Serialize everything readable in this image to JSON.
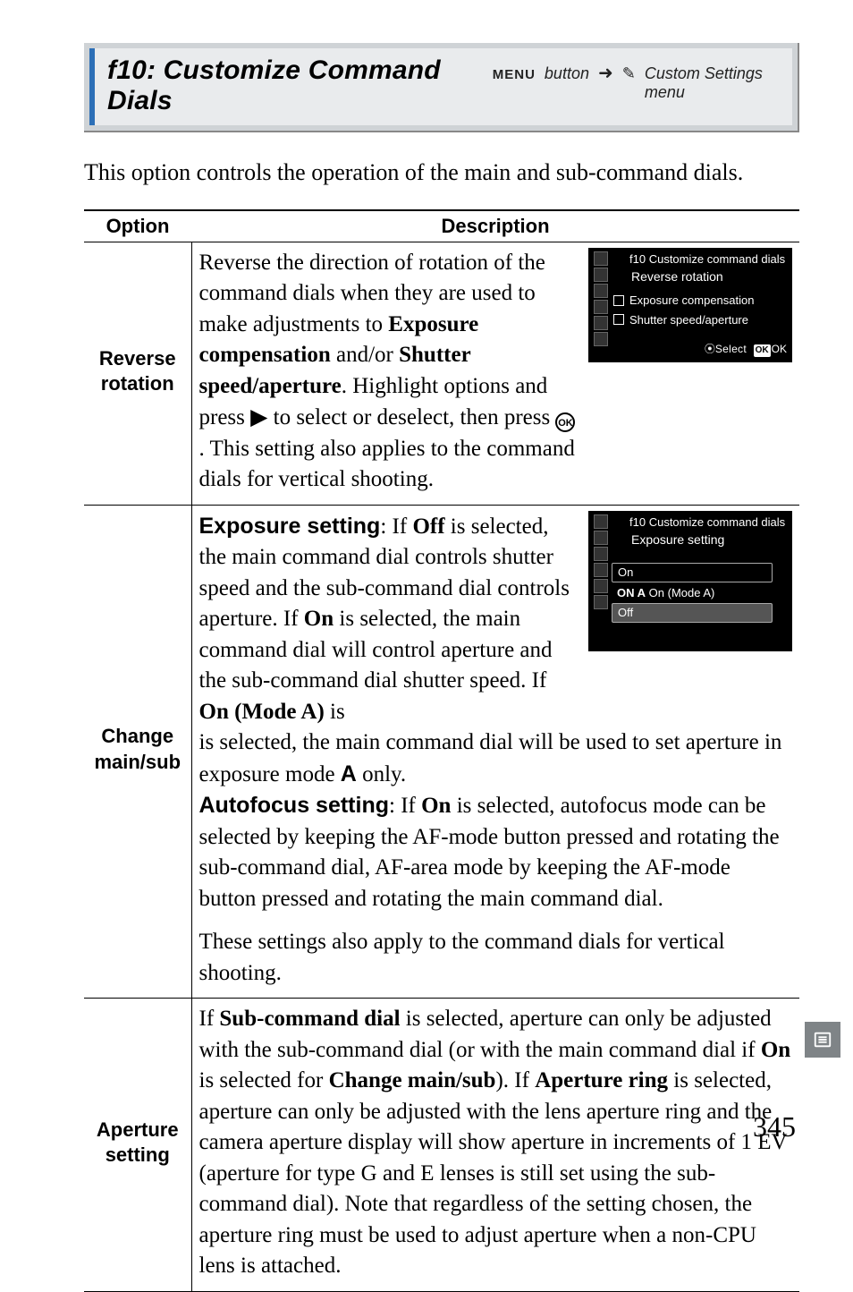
{
  "header": {
    "title": "f10: Customize Command Dials",
    "menu_label": "MENU",
    "button_label": "button",
    "arrow": "➜",
    "pencil": "✎",
    "menu_name": "Custom Settings menu"
  },
  "intro": "This option controls the operation of the main and sub-command dials.",
  "table": {
    "col_option": "Option",
    "col_desc": "Description",
    "rows": [
      {
        "name": "Reverse rotation",
        "text_parts": {
          "p1a": "Reverse the direction of rotation of the command dials when they are used to make adjustments to ",
          "b1": "Exposure compensation",
          "p1b": " and/or ",
          "b2": "Shutter speed/aperture",
          "p1c": ".  Highlight options and press ",
          "tri": "▶",
          "p1d": " to select or deselect, then press ",
          "ok": "OK",
          "p1e": ". This setting also applies to the command dials for vertical shooting."
        },
        "lcd": {
          "hdr_prefix": "f10",
          "hdr": "Customize command dials",
          "sub": "Reverse rotation",
          "opts": [
            "Exposure compensation",
            "Shutter speed/aperture"
          ],
          "footer_select": "Select",
          "footer_ok": "OK",
          "footer_ok2": "OK"
        }
      },
      {
        "name": "Change main/sub",
        "text_parts": {
          "seg1_label": "Exposure setting",
          "seg1a": ": If ",
          "seg1_off": "Off",
          "seg1b": " is selected, the main command dial controls shutter speed and the sub-command dial controls aperture.  If ",
          "seg1_on": "On",
          "seg1c": " is selected, the main command dial will control aperture and the sub-command dial shutter speed.  If ",
          "seg1_onA": "On (Mode A)",
          "seg1d": " is selected, the main command dial will be used to set aperture in exposure mode ",
          "modeA": "A",
          "seg1e": " only.",
          "seg2_label": "Autofocus setting",
          "seg2a": ": If ",
          "seg2_on": "On",
          "seg2b": " is selected, autofocus mode can be selected by keeping the AF-mode button pressed and rotating the sub-command dial, AF-area mode by keeping the AF-mode button pressed and rotating the main command dial.",
          "seg3": "These settings also apply to the command dials for vertical shooting."
        },
        "lcd": {
          "hdr_prefix": "f10",
          "hdr": "Customize command dials",
          "sub": "Exposure setting",
          "opts": [
            {
              "label": "On",
              "style": "pill"
            },
            {
              "label": "On (Mode A)",
              "prefix": "ON A",
              "style": "plain"
            },
            {
              "label": "Off",
              "style": "pill-sel"
            }
          ]
        }
      },
      {
        "name": "Aperture setting",
        "text_parts": {
          "a": "If ",
          "b1": "Sub-command dial",
          "c": " is selected, aperture can only be adjusted with the sub-command dial (or with the main command dial if ",
          "b2": "On",
          "d": " is selected for ",
          "b3": "Change main/sub",
          "e": ").  If ",
          "b4": "Aperture ring",
          "f": " is selected, aperture can only be adjusted with the lens aperture ring and the camera aperture display will show aperture in increments of 1 EV (aperture for type G and E lenses is still set using the sub-command dial).  Note that regardless of the setting chosen, the aperture ring must be used to adjust aperture when a non-CPU lens is attached."
        }
      }
    ]
  },
  "page_number": "345"
}
